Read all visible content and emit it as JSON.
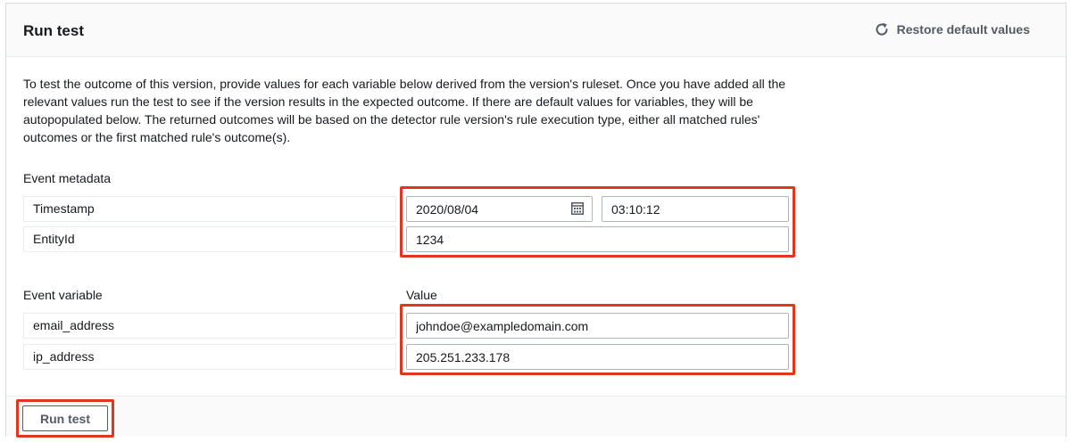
{
  "header": {
    "title": "Run test",
    "restore_label": "Restore default values",
    "restore_icon": "refresh-icon"
  },
  "description": "To test the outcome of this version, provide values for each variable below derived from the version's ruleset. Once you have added all the relevant values run the test to see if the version results in the expected outcome. If there are default values for variables, they will be autopopulated below. The returned outcomes will be based on the detector rule version's rule execution type, either all matched rules' outcomes or the first matched rule's outcome(s).",
  "metadata": {
    "section_label": "Event metadata",
    "rows": [
      {
        "name": "Timestamp",
        "date": "2020/08/04",
        "time": "03:10:12"
      },
      {
        "name": "EntityId",
        "value": "1234"
      }
    ]
  },
  "variables": {
    "section_label": "Event variable",
    "value_label": "Value",
    "rows": [
      {
        "name": "email_address",
        "value": "johndoe@exampledomain.com"
      },
      {
        "name": "ip_address",
        "value": "205.251.233.178"
      }
    ]
  },
  "footer": {
    "run_label": "Run test"
  },
  "colors": {
    "highlight": "#e0361f",
    "border": "#aab7b8",
    "text": "#16191f"
  }
}
